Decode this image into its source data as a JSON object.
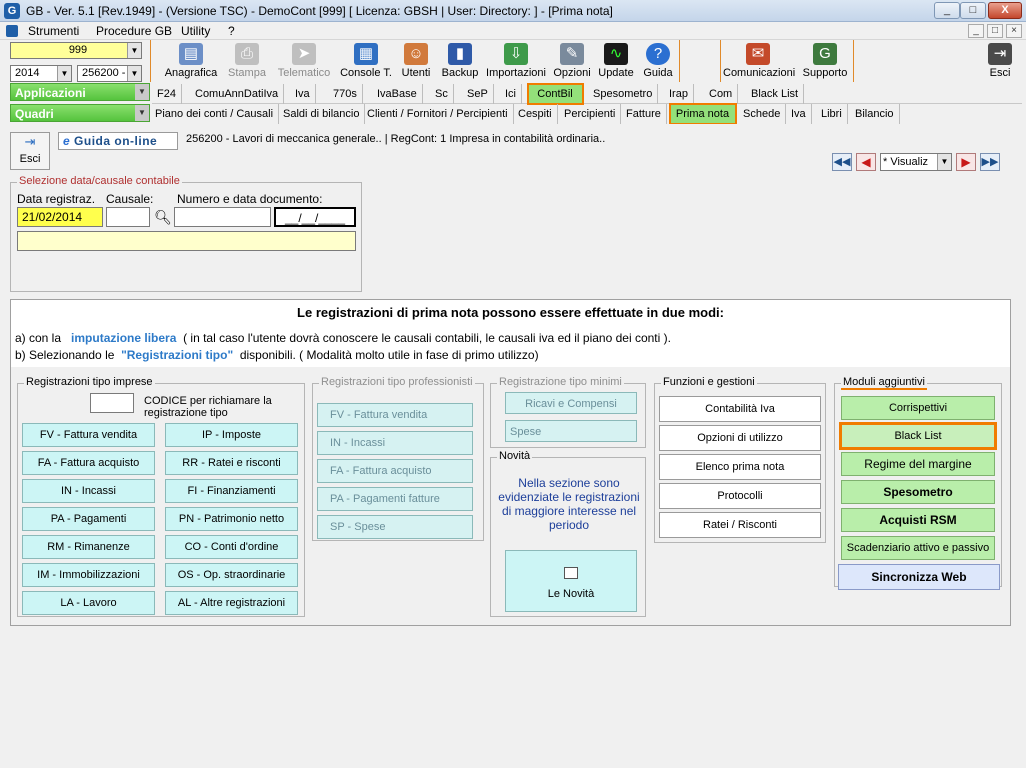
{
  "window": {
    "title": "GB - Ver. 5.1 [Rev.1949] - (Versione TSC) - DemoCont [999]    [ Licenza: GBSH | User:                  Directory:             ] - [Prima nota]",
    "logo": "G",
    "controls": [
      "_",
      "□",
      "X"
    ],
    "mdi_controls": [
      "_",
      "□",
      "×"
    ]
  },
  "menu": [
    "Strumenti",
    "Procedure GB",
    "Utility",
    "?"
  ],
  "selectors": {
    "company": "999",
    "year": "2014",
    "code": "256200 -"
  },
  "side_buttons": {
    "applicazioni": "Applicazioni",
    "quadri": "Quadri"
  },
  "toolbar": {
    "buttons": [
      {
        "label": "Anagrafica",
        "icon": "card-icon",
        "enabled": true
      },
      {
        "label": "Stampa",
        "icon": "printer-icon",
        "enabled": false
      },
      {
        "label": "Telematico",
        "icon": "send-icon",
        "enabled": false
      },
      {
        "label": "Console T.",
        "icon": "console-icon",
        "enabled": true
      },
      {
        "label": "Utenti",
        "icon": "users-icon",
        "enabled": true
      },
      {
        "label": "Backup",
        "icon": "backup-icon",
        "enabled": true
      },
      {
        "label": "Importazioni",
        "icon": "import-icon",
        "enabled": true
      },
      {
        "label": "Opzioni",
        "icon": "wrench-icon",
        "enabled": true
      },
      {
        "label": "Update",
        "icon": "update-icon",
        "enabled": true
      },
      {
        "label": "Guida",
        "icon": "help-icon",
        "enabled": true
      },
      {
        "label": "Comunicazioni",
        "icon": "messages-icon",
        "enabled": true
      },
      {
        "label": "Supporto",
        "icon": "support-icon",
        "enabled": true
      },
      {
        "label": "Esci",
        "icon": "exit-icon",
        "enabled": true
      }
    ]
  },
  "nav_apps": [
    "F24",
    "ComuAnnDatiIva",
    "Iva",
    "770s",
    "IvaBase",
    "Sc",
    "SeP",
    "Ici",
    "ContBil",
    "Spesometro",
    "Irap",
    "Com",
    "Black List"
  ],
  "nav_quadri": [
    "Piano dei conti / Causali",
    "Saldi di bilancio",
    "Clienti / Fornitori / Percipienti",
    "Cespiti",
    "Percipienti",
    "Fatture",
    "Prima nota",
    "Schede",
    "Iva",
    "Libri",
    "Bilancio"
  ],
  "subbar": {
    "esci": "Esci",
    "guida": "Guida on-line",
    "info": "256200 - Lavori di meccanica generale..  | RegCont: 1 Impresa  in contabilità ordinaria..",
    "view_mode": "* Visualiz"
  },
  "selection": {
    "legend": "Selezione data/causale contabile",
    "date_label": "Data registraz.",
    "causale_label": "Causale:",
    "doc_label": "Numero e data documento:",
    "date_value": "21/02/2014",
    "doc_date_placeholder": "__/__/____"
  },
  "info_box": {
    "heading": "Le registrazioni di prima nota possono essere effettuate in due modi:",
    "line_a_pre": "a) con la",
    "line_a_link": "imputazione libera",
    "line_a_post": "( in tal caso l'utente dovrà conoscere le causali contabili, le causali iva ed il piano dei conti ).",
    "line_b_pre": "b) Selezionando le",
    "line_b_link": "\"Registrazioni tipo\"",
    "line_b_post": "disponibili. ( Modalità molto utile in fase di primo utilizzo)"
  },
  "imprese": {
    "legend": "Registrazioni tipo imprese",
    "code_hint": "CODICE per richiamare la registrazione tipo",
    "buttons": [
      [
        "FV - Fattura vendita",
        "IP - Imposte"
      ],
      [
        "FA - Fattura acquisto",
        "RR - Ratei e risconti"
      ],
      [
        "IN - Incassi",
        "FI - Finanziamenti"
      ],
      [
        "PA - Pagamenti",
        "PN - Patrimonio netto"
      ],
      [
        "RM - Rimanenze",
        "CO - Conti d'ordine"
      ],
      [
        "IM - Immobilizzazioni",
        "OS - Op. straordinarie"
      ],
      [
        "LA - Lavoro",
        "AL - Altre registrazioni"
      ]
    ]
  },
  "professionisti": {
    "legend": "Registrazioni tipo professionisti",
    "buttons": [
      "FV - Fattura vendita",
      "IN - Incassi",
      "FA - Fattura acquisto",
      "PA - Pagamenti fatture",
      "SP - Spese"
    ]
  },
  "minimi": {
    "legend": "Registrazione tipo minimi",
    "buttons": [
      "Ricavi e Compensi",
      "Spese"
    ]
  },
  "novita": {
    "legend": "Novità",
    "text": "Nella sezione sono evidenziate le registrazioni di maggiore interesse nel periodo",
    "button": "Le Novità"
  },
  "funzioni": {
    "legend": "Funzioni e gestioni",
    "buttons": [
      "Contabilità Iva",
      "Opzioni di utilizzo",
      "Elenco prima nota",
      "Protocolli",
      "Ratei / Risconti"
    ]
  },
  "moduli": {
    "legend": "Moduli aggiuntivi",
    "buttons": [
      "Corrispettivi",
      "Black List",
      "Regime del margine",
      "Spesometro",
      "Acquisti RSM",
      "Scadenziario attivo e passivo"
    ],
    "sync": "Sincronizza Web"
  },
  "colors": {
    "accent_green": "#55c33d",
    "highlight_orange": "#f07c00",
    "link_blue": "#2d7ac8",
    "cyan_button": "#ccf5f5"
  }
}
